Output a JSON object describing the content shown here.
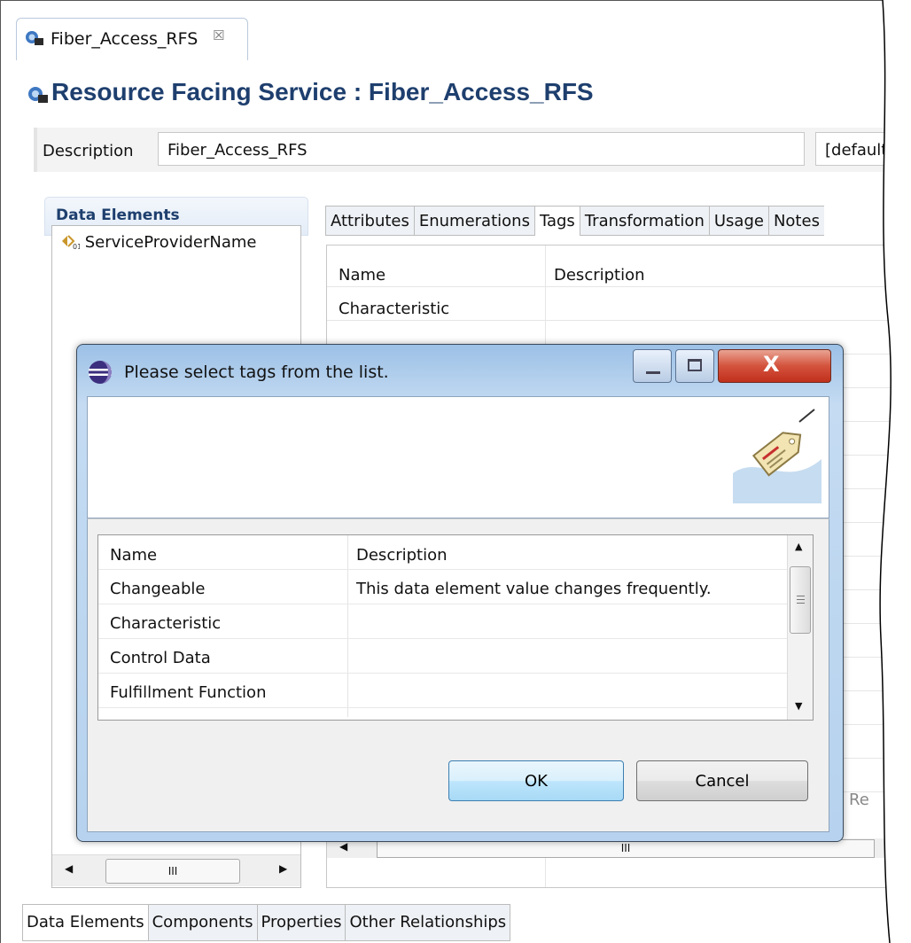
{
  "editor_tab": {
    "label": "Fiber_Access_RFS",
    "close_glyph": "☒"
  },
  "title": "Resource Facing Service : Fiber_Access_RFS",
  "description": {
    "label": "Description",
    "value": "Fiber_Access_RFS",
    "extra": "[default]"
  },
  "left_panel": {
    "header": "Data Elements",
    "items": [
      "ServiceProviderName"
    ],
    "hscroll_glyph": "III"
  },
  "right_tabs": [
    "Attributes",
    "Enumerations",
    "Tags",
    "Transformation",
    "Usage",
    "Notes"
  ],
  "tags_table": {
    "columns": [
      "Name",
      "Description"
    ],
    "rows": [
      [
        "Characteristic",
        ""
      ]
    ],
    "hscroll_glyph": "III",
    "partial_text": "Re"
  },
  "bottom_tabs": [
    "Data Elements",
    "Components",
    "Properties",
    "Other Relationships"
  ],
  "dialog": {
    "title": "Please select tags from the list.",
    "columns": [
      "Name",
      "Description"
    ],
    "rows": [
      [
        "Changeable",
        "This data element value changes frequently."
      ],
      [
        "Characteristic",
        ""
      ],
      [
        "Control Data",
        ""
      ],
      [
        "Fulfillment Function",
        ""
      ]
    ],
    "ok_label": "OK",
    "cancel_label": "Cancel",
    "close_glyph": "X"
  },
  "icons": [
    "rfs-icon",
    "data-element-icon",
    "eclipse-icon",
    "tag-icon",
    "minimize-icon",
    "maximize-icon",
    "close-icon"
  ],
  "colors": {
    "title": "#1e3f6e",
    "dialog_frame": "#b6d2ee",
    "close_button": "#c0301c"
  }
}
